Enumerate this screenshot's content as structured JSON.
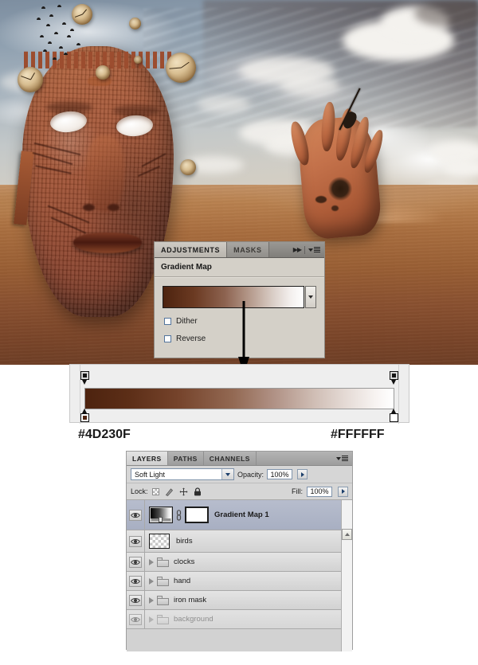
{
  "artwork": {
    "description": "Surreal desert photo composite: cracked terracotta face mask and a hand emerging from sand dunes under a cloudy sky, with floating antique pocket watches and a flock of birds",
    "elements": [
      "face-mask",
      "hand",
      "clocks",
      "birds",
      "sand-dunes",
      "clouds"
    ]
  },
  "adjustments_panel": {
    "tabs": [
      {
        "label": "ADJUSTMENTS",
        "active": true
      },
      {
        "label": "MASKS",
        "active": false
      }
    ],
    "title": "Gradient Map",
    "gradient_preview_colors": [
      "#4D230F",
      "#FFFFFF"
    ],
    "checkboxes": [
      {
        "label": "Dither",
        "checked": false
      },
      {
        "label": "Reverse",
        "checked": false
      }
    ],
    "icons": {
      "fast_forward": "fast-forward-icon",
      "panel_menu": "panel-menu-icon",
      "gradient_dropdown": "chevron-down-icon"
    }
  },
  "gradient_editor": {
    "stops": [
      {
        "position": "left",
        "color": "#4D230F",
        "opacity_stop_color": "#000000"
      },
      {
        "position": "right",
        "color": "#FFFFFF",
        "opacity_stop_color": "#000000"
      }
    ],
    "hex_left": "#4D230F",
    "hex_right": "#FFFFFF"
  },
  "layers_panel": {
    "tabs": [
      {
        "label": "LAYERS",
        "active": true
      },
      {
        "label": "PATHS",
        "active": false
      },
      {
        "label": "CHANNELS",
        "active": false
      }
    ],
    "blend_mode": "Soft Light",
    "opacity_label": "Opacity:",
    "opacity_value": "100%",
    "lock_label": "Lock:",
    "lock_icons": [
      "transparency-lock-icon",
      "brush-lock-icon",
      "move-lock-icon",
      "lock-all-icon"
    ],
    "fill_label": "Fill:",
    "fill_value": "100%",
    "rows": [
      {
        "name": "Gradient Map 1",
        "type": "adjustment",
        "visible": true,
        "selected": true,
        "dimmed": false,
        "expandable": false
      },
      {
        "name": "birds",
        "type": "pixel",
        "visible": true,
        "selected": false,
        "dimmed": false,
        "expandable": false
      },
      {
        "name": "clocks",
        "type": "group",
        "visible": true,
        "selected": false,
        "dimmed": false,
        "expandable": true
      },
      {
        "name": "hand",
        "type": "group",
        "visible": true,
        "selected": false,
        "dimmed": false,
        "expandable": true
      },
      {
        "name": "iron mask",
        "type": "group",
        "visible": true,
        "selected": false,
        "dimmed": false,
        "expandable": true
      },
      {
        "name": "background",
        "type": "group",
        "visible": true,
        "selected": false,
        "dimmed": true,
        "expandable": true
      }
    ]
  }
}
